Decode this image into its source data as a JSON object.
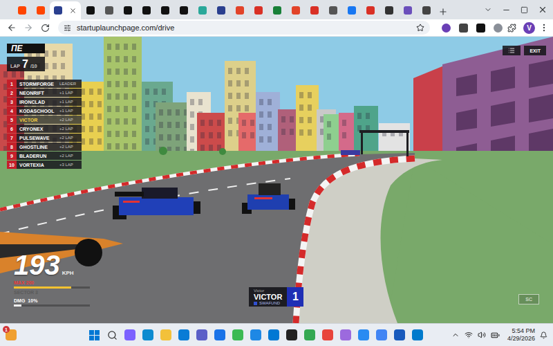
{
  "browser": {
    "tabs": [
      {
        "color": "#ff4500",
        "selected": false
      },
      {
        "color": "#ff4500",
        "selected": false
      },
      {
        "color": "#2a3f8f",
        "selected": true
      },
      {
        "color": "#111111",
        "selected": false
      },
      {
        "color": "#555555",
        "selected": false
      },
      {
        "color": "#111111",
        "selected": false
      },
      {
        "color": "#111111",
        "selected": false
      },
      {
        "color": "#111111",
        "selected": false
      },
      {
        "color": "#111111",
        "selected": false
      },
      {
        "color": "#2aa89a",
        "selected": false
      },
      {
        "color": "#2a3f8f",
        "selected": false
      },
      {
        "color": "#e24329",
        "selected": false
      },
      {
        "color": "#d93025",
        "selected": false
      },
      {
        "color": "#188038",
        "selected": false
      },
      {
        "color": "#e24329",
        "selected": false
      },
      {
        "color": "#d93025",
        "selected": false
      },
      {
        "color": "#555555",
        "selected": false
      },
      {
        "color": "#1877f2",
        "selected": false
      },
      {
        "color": "#d93025",
        "selected": false
      },
      {
        "color": "#333333",
        "selected": false
      },
      {
        "color": "#6b4fbb",
        "selected": false
      },
      {
        "color": "#444444",
        "selected": false
      }
    ],
    "address": "startuplaunchpage.com/drive",
    "profile": "V"
  },
  "game": {
    "logo": "ΠE",
    "lap": {
      "label": "LAP",
      "current": "7",
      "total": "/10"
    },
    "standings": [
      {
        "position": "1",
        "name": "STORMFORGE",
        "gap": "LEADER",
        "selected": false
      },
      {
        "position": "2",
        "name": "NEONRIFT",
        "gap": "+1 LAP",
        "selected": false
      },
      {
        "position": "3",
        "name": "IRONCLAD",
        "gap": "+1 LAP",
        "selected": false
      },
      {
        "position": "4",
        "name": "KODASCHOOL",
        "gap": "+1 LAP",
        "selected": false
      },
      {
        "position": "5",
        "name": "VICTOR",
        "gap": "+2 LAP",
        "selected": true
      },
      {
        "position": "6",
        "name": "CRYONEX",
        "gap": "+2 LAP",
        "selected": false
      },
      {
        "position": "7",
        "name": "PULSEWAVE",
        "gap": "+2 LAP",
        "selected": false
      },
      {
        "position": "8",
        "name": "GHOSTLINE",
        "gap": "+2 LAP",
        "selected": false
      },
      {
        "position": "9",
        "name": "BLADERUN",
        "gap": "+2 LAP",
        "selected": false
      },
      {
        "position": "10",
        "name": "VORTEXIA",
        "gap": "+3 LAP",
        "selected": false
      }
    ],
    "exit_button": "EXIT",
    "speed": {
      "value": "193",
      "unit": "KPH",
      "max": "MAX 200",
      "level": 0.75
    },
    "sector": "SECTOR 3",
    "damage": {
      "label": "DMG",
      "value": "10%",
      "level": 0.1
    },
    "player_card": {
      "caption": "Victor",
      "name": "VICTOR",
      "team": "SWAFUND",
      "position": "1"
    },
    "corner_badge": "SC"
  },
  "taskbar": {
    "items": [
      {
        "kind": "widget",
        "color": "#f0a030",
        "badge": "1"
      },
      {
        "kind": "start",
        "color": "#0078d4"
      },
      {
        "kind": "search",
        "color": "#333333"
      },
      {
        "kind": "app",
        "color": "#7b61ff"
      },
      {
        "kind": "app",
        "color": "#0c8bd0"
      },
      {
        "kind": "app",
        "color": "#f3c13a"
      },
      {
        "kind": "app",
        "color": "#0a7cd6"
      },
      {
        "kind": "app",
        "color": "#5b5fc7"
      },
      {
        "kind": "app",
        "color": "#1a73e8"
      },
      {
        "kind": "app",
        "color": "#3cba54"
      },
      {
        "kind": "app",
        "color": "#1e88e5"
      },
      {
        "kind": "app",
        "color": "#0078d4"
      },
      {
        "kind": "app",
        "color": "#222222"
      },
      {
        "kind": "app",
        "color": "#34a853"
      },
      {
        "kind": "app",
        "color": "#e8453c"
      },
      {
        "kind": "app",
        "color": "#9c6ade"
      },
      {
        "kind": "app",
        "color": "#2a8bf2"
      },
      {
        "kind": "app",
        "color": "#4285f4"
      },
      {
        "kind": "app",
        "color": "#185abd"
      },
      {
        "kind": "app",
        "color": "#007acc"
      }
    ],
    "time": "5:54 PM",
    "date": "4/29/2026"
  }
}
